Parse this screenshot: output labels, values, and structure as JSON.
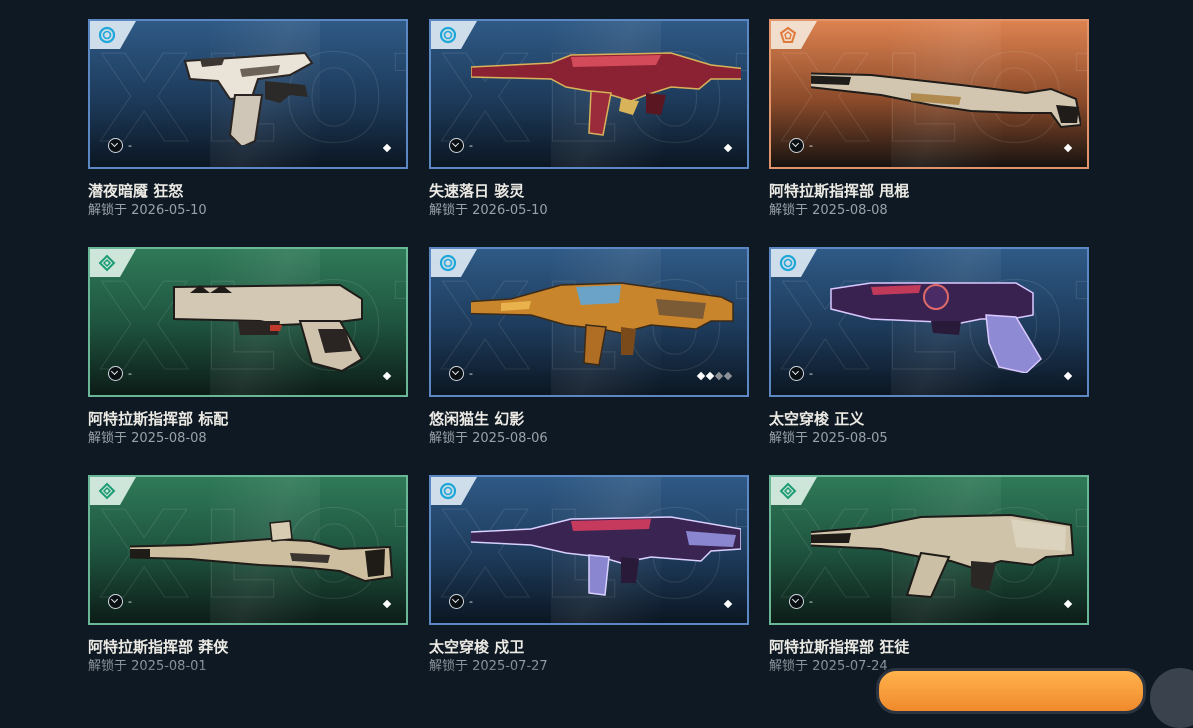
{
  "unlock_prefix": "解锁于",
  "items": [
    {
      "name": "潜夜暗魇 狂怒",
      "date": "解锁于 2026-05-10",
      "tier": "select",
      "theme": "blue",
      "level": "-",
      "variants_total": 1,
      "variants_owned": 1
    },
    {
      "name": "失速落日 骇灵",
      "date": "解锁于 2026-05-10",
      "tier": "select",
      "theme": "blue",
      "level": "-",
      "variants_total": 1,
      "variants_owned": 1
    },
    {
      "name": "阿特拉斯指挥部 甩棍",
      "date": "解锁于 2025-08-08",
      "tier": "exclusive",
      "theme": "orange",
      "level": "-",
      "variants_total": 1,
      "variants_owned": 1
    },
    {
      "name": "阿特拉斯指挥部 标配",
      "date": "解锁于 2025-08-08",
      "tier": "deluxe",
      "theme": "green",
      "level": "-",
      "variants_total": 1,
      "variants_owned": 1
    },
    {
      "name": "悠闲猫生 幻影",
      "date": "解锁于 2025-08-06",
      "tier": "select",
      "theme": "blue",
      "level": "-",
      "variants_total": 4,
      "variants_owned": 2
    },
    {
      "name": "太空穿梭 正义",
      "date": "解锁于 2025-08-05",
      "tier": "select",
      "theme": "blue",
      "level": "-",
      "variants_total": 1,
      "variants_owned": 1
    },
    {
      "name": "阿特拉斯指挥部 莽侠",
      "date": "解锁于 2025-08-01",
      "tier": "deluxe",
      "theme": "green",
      "level": "-",
      "variants_total": 1,
      "variants_owned": 1
    },
    {
      "name": "太空穿梭 戍卫",
      "date": "解锁于 2025-07-27",
      "tier": "select",
      "theme": "blue",
      "level": "-",
      "variants_total": 1,
      "variants_owned": 1
    },
    {
      "name": "阿特拉斯指挥部 狂徒",
      "date": "解锁于 2025-07-24",
      "tier": "deluxe",
      "theme": "green",
      "level": "-",
      "variants_total": 1,
      "variants_owned": 1
    }
  ],
  "watermark_text": "XLOT",
  "icons": {
    "tier_select": "select-tier-icon",
    "tier_deluxe": "deluxe-tier-icon",
    "tier_exclusive": "exclusive-tier-icon",
    "level": "radianite-level-icon",
    "variant": "variant-diamond-icon"
  },
  "colors": {
    "background": "#0f1923",
    "blue": "#2f5a86",
    "orange": "#dd8250",
    "green": "#2f7a58",
    "accent": "#f5a23a"
  }
}
